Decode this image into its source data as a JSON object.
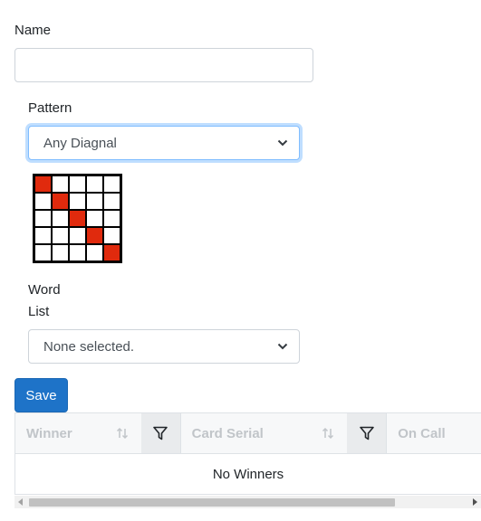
{
  "form": {
    "name_label": "Name",
    "name_value": "",
    "pattern_label": "Pattern",
    "pattern_selected": "Any Diagnal",
    "pattern_grid": [
      [
        1,
        0,
        0,
        0,
        0
      ],
      [
        0,
        1,
        0,
        0,
        0
      ],
      [
        0,
        0,
        1,
        0,
        0
      ],
      [
        0,
        0,
        0,
        1,
        0
      ],
      [
        0,
        0,
        0,
        0,
        1
      ]
    ],
    "word_list_label_line1": "Word",
    "word_list_label_line2": "List",
    "word_list_selected": "None selected.",
    "save_label": "Save"
  },
  "grid": {
    "columns": [
      {
        "label": "Winner",
        "sortable": true,
        "filterable": true
      },
      {
        "label": "Card Serial",
        "sortable": true,
        "filterable": true
      },
      {
        "label": "On Call",
        "sortable": false,
        "filterable": false
      }
    ],
    "empty_message": "No Winners"
  },
  "colors": {
    "accent": "#1e73c8",
    "marked_cell": "#e02a0d",
    "focus_border": "#80bdff"
  },
  "icons": {
    "select_caret": "chevron-down-icon",
    "sort": "sort-arrows-icon",
    "filter": "filter-funnel-icon",
    "scroll_left": "caret-left-icon",
    "scroll_right": "caret-right-icon"
  }
}
